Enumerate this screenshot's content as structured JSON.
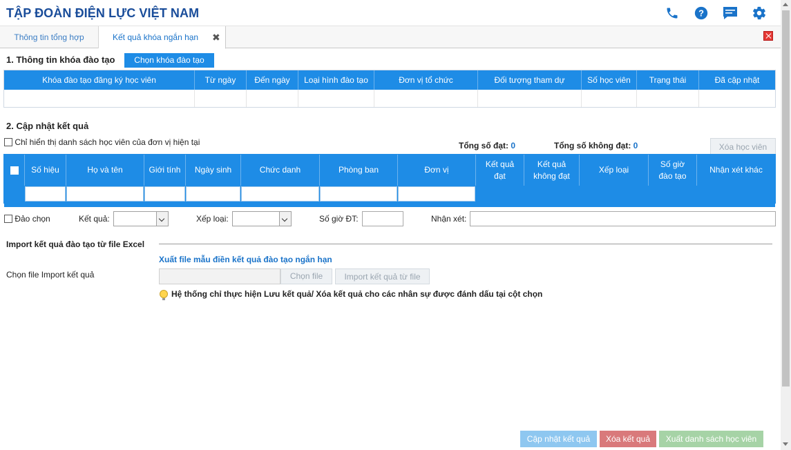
{
  "app": {
    "title": "TẬP ĐOÀN ĐIỆN LỰC VIỆT NAM"
  },
  "icons": {
    "phone": "phone-icon",
    "help": "help-icon",
    "chat": "chat-icon",
    "settings": "gear-icon",
    "close_all": "close-icon",
    "lightbulb": "lightbulb-icon"
  },
  "colors": {
    "brand": "#1a4d9a",
    "accent": "#1e8ce6",
    "save_btn": "#8ec7f0",
    "delete_btn": "#d9797b",
    "export_btn": "#a6d3a6"
  },
  "tabs": [
    {
      "label": "Thông tin tổng hợp",
      "active": false
    },
    {
      "label": "Kết quả khóa ngắn hạn",
      "active": true,
      "close": "✖"
    }
  ],
  "section1": {
    "title": "1. Thông tin khóa đào tạo",
    "choose_button": "Chọn khóa đào tạo",
    "columns": [
      "Khóa đào tạo đăng ký học viên",
      "Từ ngày",
      "Đến ngày",
      "Loại hình đào tạo",
      "Đơn vị tổ chức",
      "Đối tượng tham dự",
      "Số học viên",
      "Trạng thái",
      "Đã cập nhật"
    ]
  },
  "section2": {
    "title": "2. Cập nhật kết quả",
    "only_unit_label": "Chỉ hiển thị danh sách học viên của đơn vị hiện tại",
    "passed_label": "Tổng số đạt:",
    "passed_value": "0",
    "failed_label": "Tổng số không đạt:",
    "failed_value": "0",
    "delete_student_button": "Xóa học viên",
    "columns": [
      "Số hiệu",
      "Họ và tên",
      "Giới tính",
      "Ngày sinh",
      "Chức danh",
      "Phòng ban",
      "Đơn vị",
      "Kết quả đạt",
      "Kết quả không đạt",
      "Xếp loại",
      "Số giờ đào tạo",
      "Nhận xét khác"
    ]
  },
  "controls": {
    "invert_label": "Đảo chọn",
    "result_label": "Kết quả:",
    "result_value": "",
    "rank_label": "Xếp loại:",
    "rank_value": "",
    "hours_label": "Số giờ ĐT:",
    "hours_value": "",
    "comment_label": "Nhận xét:",
    "comment_value": ""
  },
  "import": {
    "title": "Import kết quả đào tạo từ file Excel",
    "template_link": "Xuất file mẫu điền kết quả đào tạo ngắn hạn",
    "choose_file_label": "Chọn file Import kết quả",
    "file_value": "",
    "choose_file_button": "Chọn file",
    "import_button": "Import kết quả từ file",
    "note": "Hệ thống chỉ thực hiện Lưu kết quả/ Xóa kết quả cho các nhân sự được đánh dấu tại cột chọn"
  },
  "footer": {
    "save_button": "Cập nhật kết quả",
    "delete_button": "Xóa kết quả",
    "export_button": "Xuất danh sách học viên"
  }
}
